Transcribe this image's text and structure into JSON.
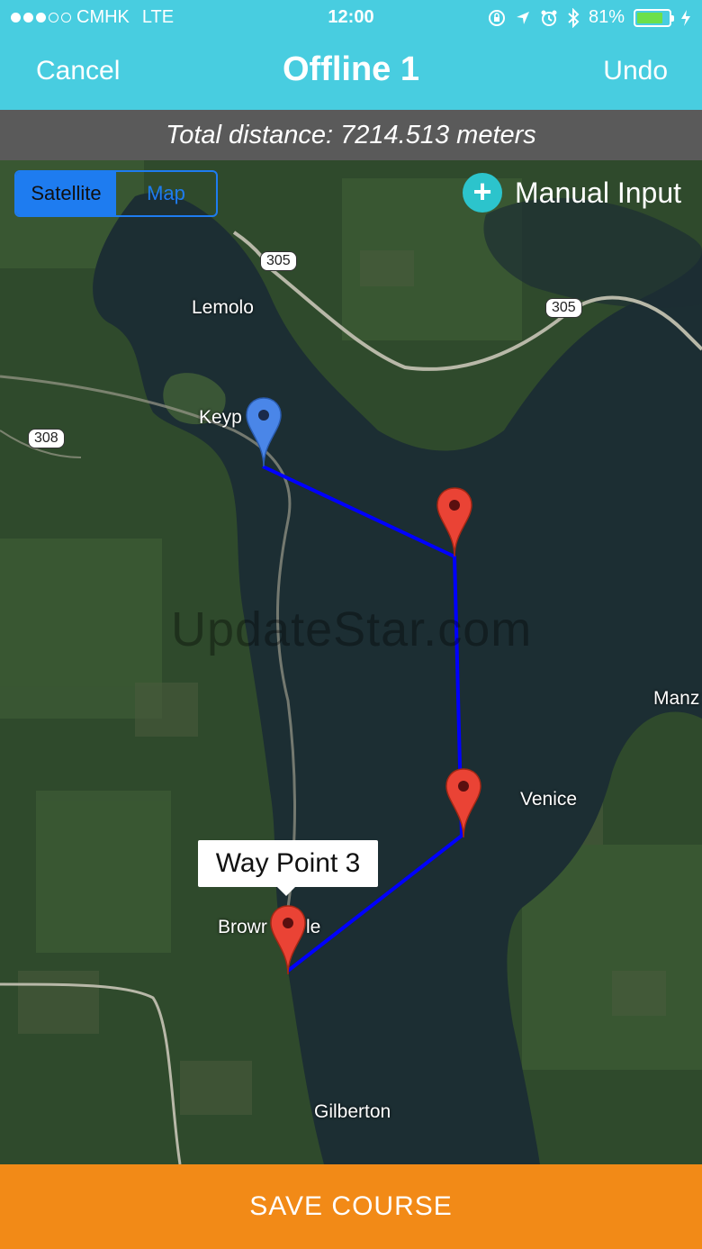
{
  "status_bar": {
    "carrier": "CMHK",
    "network": "LTE",
    "time": "12:00",
    "battery": "81%",
    "battery_level": 0.81
  },
  "nav": {
    "cancel_label": "Cancel",
    "title": "Offline 1",
    "undo_label": "Undo"
  },
  "distance_text": "Total distance: 7214.513 meters",
  "map": {
    "toggle": {
      "satellite_label": "Satellite",
      "map_label": "Map",
      "selected": "Satellite"
    },
    "manual_input_label": "Manual Input",
    "places": {
      "lemolo": "Lemolo",
      "keyport": "Keyp",
      "venice": "Venice",
      "brownsville": "Browr",
      "brownsville_tail": "le",
      "gilberton": "Gilberton",
      "manzanita": "Manz"
    },
    "route_shields": {
      "sr305_a": "305",
      "sr305_b": "305",
      "sr308": "308"
    },
    "watermark": "UpdateStar.com",
    "callout": "Way Point 3",
    "colors": {
      "route": "#0000ff",
      "start_pin": "#4a86e8",
      "waypoint_pin": "#ea4335"
    }
  },
  "save_label": "SAVE COURSE"
}
